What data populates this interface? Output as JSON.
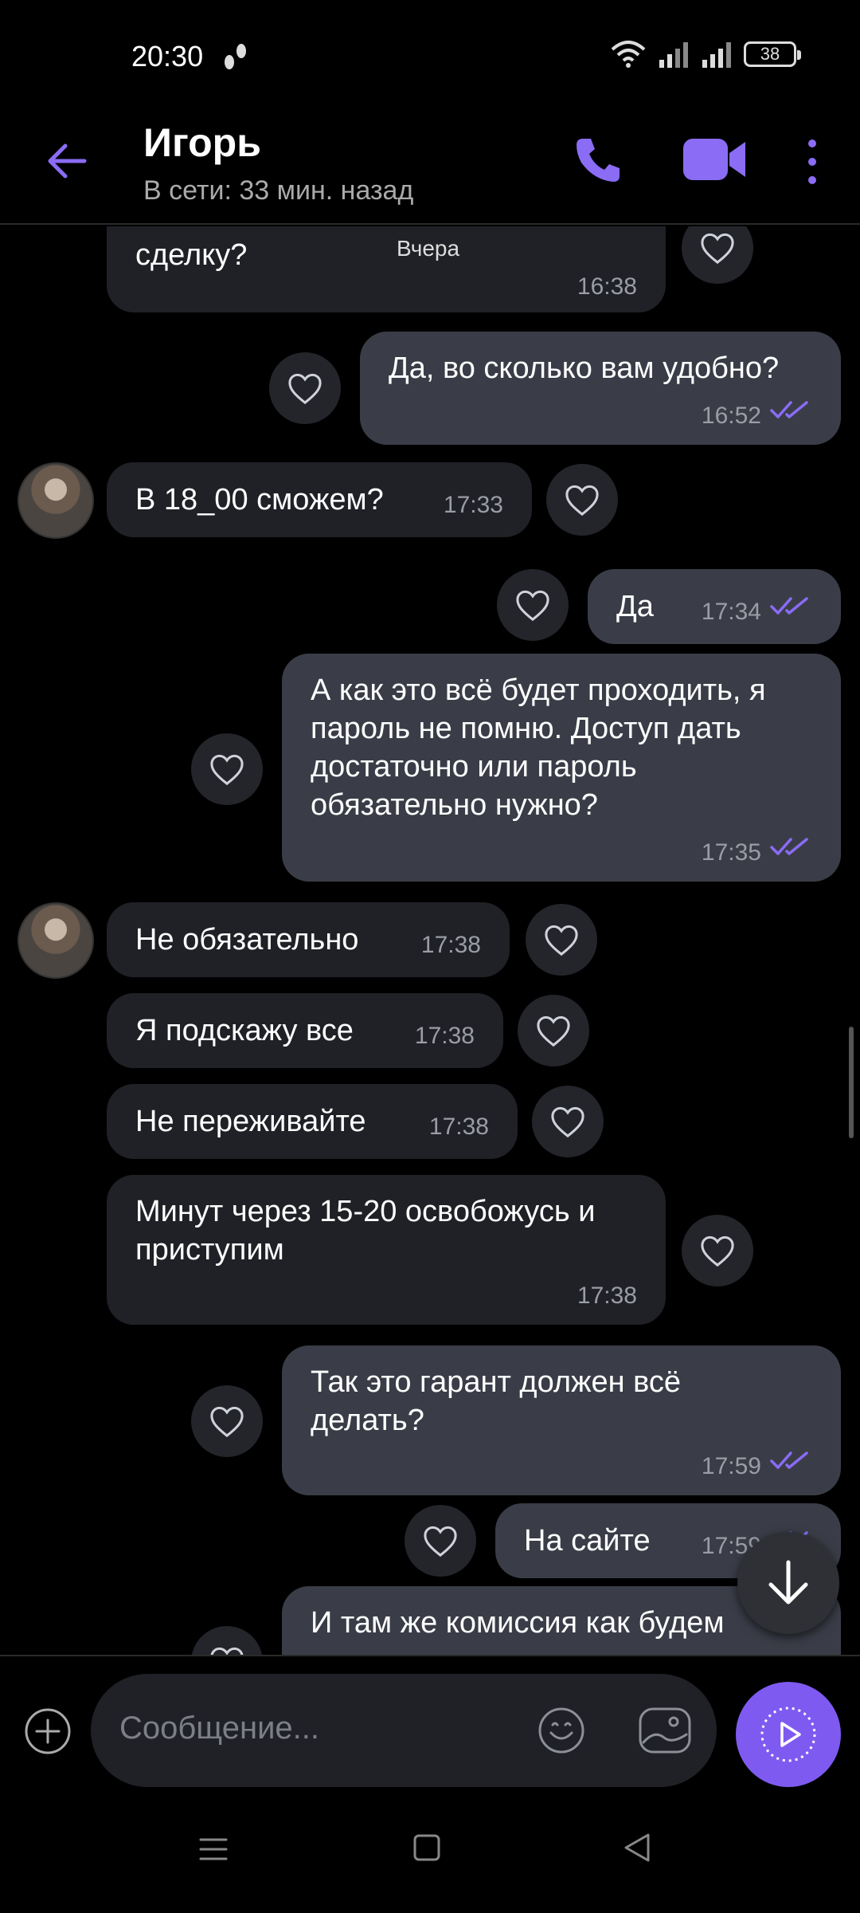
{
  "status_bar": {
    "time": "20:30",
    "battery": "38"
  },
  "header": {
    "name": "Игорь",
    "status": "В сети: 33 мин. назад"
  },
  "chat": {
    "date_separator": "Вчера",
    "messages": [
      {
        "dir": "in",
        "text": "сделку?",
        "time": "16:38"
      },
      {
        "dir": "out",
        "text": "Да, во сколько вам удобно?",
        "time": "16:52"
      },
      {
        "dir": "in",
        "text": "В 18_00 сможем?",
        "time": "17:33"
      },
      {
        "dir": "out",
        "text": "Да",
        "time": "17:34"
      },
      {
        "dir": "out",
        "text": "А как это всё будет проходить, я пароль не помню. Доступ дать достаточно или пароль обязательно нужно?",
        "time": "17:35"
      },
      {
        "dir": "in",
        "text": "Не обязательно",
        "time": "17:38"
      },
      {
        "dir": "in",
        "text": "Я подскажу все",
        "time": "17:38"
      },
      {
        "dir": "in",
        "text": "Не переживайте",
        "time": "17:38"
      },
      {
        "dir": "in",
        "text": "Минут через 15-20 освобожусь и приступим",
        "time": "17:38"
      },
      {
        "dir": "out",
        "text": "Так это гарант должен всё делать?",
        "time": "17:59"
      },
      {
        "dir": "out",
        "text": "На сайте",
        "time": "17:59"
      },
      {
        "dir": "out",
        "text": "И там же комиссия как будем",
        "time": ""
      }
    ]
  },
  "composer": {
    "placeholder": "Сообщение..."
  },
  "colors": {
    "accent": "#7f5af0",
    "bubble_in": "#1f2126",
    "bubble_out": "#3a3d47"
  },
  "icons": [
    "back-arrow-icon",
    "phone-icon",
    "video-icon",
    "more-vertical-icon",
    "heart-icon",
    "double-check-icon",
    "plus-icon",
    "emoji-icon",
    "gallery-icon",
    "send-icon",
    "arrow-down-icon"
  ]
}
